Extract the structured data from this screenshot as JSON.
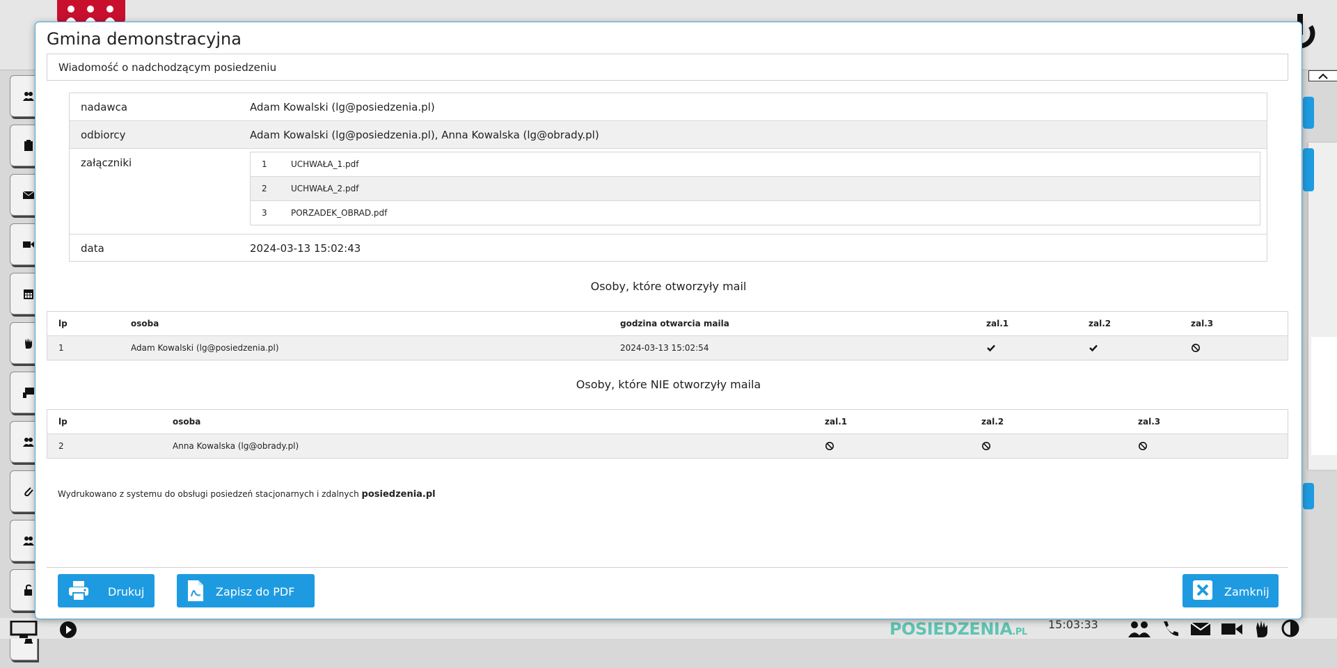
{
  "app": {
    "clock": "15:03:33",
    "brand": "POSIEDZENIA",
    "brand_suffix": ".PL"
  },
  "modal": {
    "title": "Gmina demonstracyjna",
    "subject": "Wiadomość o nadchodzącym posiedzeniu",
    "info": {
      "sender_label": "nadawca",
      "sender_value": "Adam Kowalski (lg@posiedzenia.pl)",
      "recipients_label": "odbiorcy",
      "recipients_value": "Adam Kowalski (lg@posiedzenia.pl), Anna Kowalska (lg@obrady.pl)",
      "attachments_label": "załączniki",
      "attachments": [
        {
          "no": "1",
          "name": "UCHWAŁA_1.pdf"
        },
        {
          "no": "2",
          "name": "UCHWAŁA_2.pdf"
        },
        {
          "no": "3",
          "name": "PORZADEK_OBRAD.pdf"
        }
      ],
      "date_label": "data",
      "date_value": "2024-03-13 15:02:43"
    },
    "opened": {
      "title": "Osoby, które otworzyły mail",
      "headers": [
        "lp",
        "osoba",
        "godzina otwarcia maila",
        "zal.1",
        "zal.2",
        "zal.3"
      ],
      "rows": [
        {
          "lp": "1",
          "person": "Adam Kowalski (lg@posiedzenia.pl)",
          "time": "2024-03-13 15:02:54",
          "att": [
            "check",
            "check",
            "ban"
          ]
        }
      ]
    },
    "not_opened": {
      "title": "Osoby, które NIE otworzyły maila",
      "headers": [
        "lp",
        "osoba",
        "zal.1",
        "zal.2",
        "zal.3"
      ],
      "rows": [
        {
          "lp": "2",
          "person": "Anna Kowalska (lg@obrady.pl)",
          "att": [
            "ban",
            "ban",
            "ban"
          ]
        }
      ]
    },
    "footer_note": "Wydrukowano z systemu do obsługi posiedzeń stacjonarnych i zdalnych",
    "footer_brand": "posiedzenia.pl",
    "buttons": {
      "print": "Drukuj",
      "pdf": "Zapisz do PDF",
      "close": "Zamknij"
    }
  },
  "icons": {
    "check": "check-icon",
    "ban": "ban-icon",
    "print": "printer-icon",
    "pdf": "pdf-file-icon",
    "close": "close-icon"
  },
  "colors": {
    "accent": "#1e9be0",
    "brand": "#5fc4b2",
    "logo": "#c8102e"
  }
}
